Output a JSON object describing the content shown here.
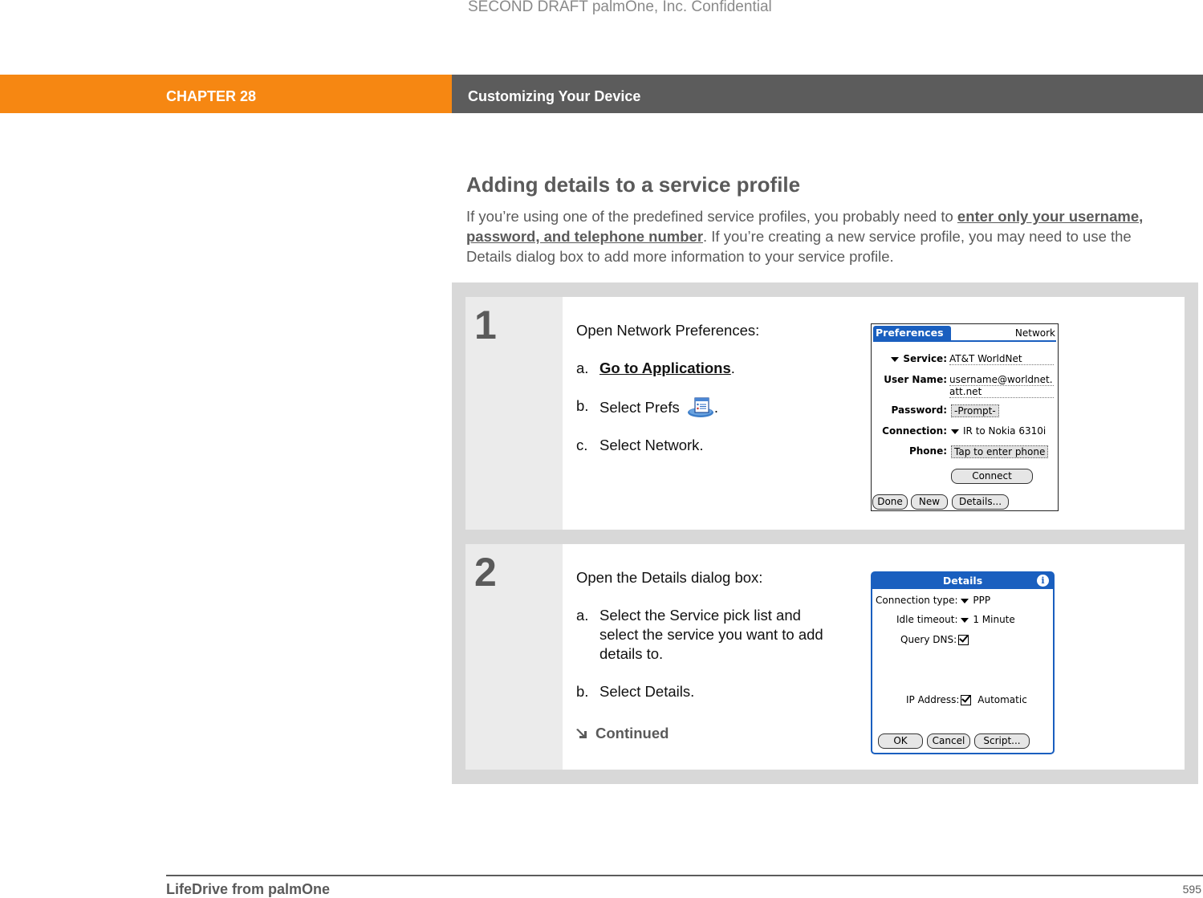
{
  "watermark": "SECOND DRAFT palmOne, Inc.  Confidential",
  "header": {
    "chapter_label": "CHAPTER 28",
    "chapter_title": "Customizing Your Device",
    "colors": {
      "chapter_bg": "#f68712",
      "title_bg": "#5c5c5c"
    }
  },
  "section": {
    "title": "Adding details to a service profile",
    "intro_before": "If you’re using one of the predefined service profiles, you probably need to ",
    "intro_link": "enter only your username, password, and telephone number",
    "intro_after": ". If you’re creating a new service profile, you may need to use the Details dialog box to add more information to your service profile."
  },
  "steps": [
    {
      "number": "1",
      "heading": "Open Network Preferences:",
      "items": [
        {
          "label": "a.",
          "link": "Go to Applications",
          "after": "."
        },
        {
          "label": "b.",
          "text": "Select Prefs",
          "icon": "prefs-app-icon",
          "after": "."
        },
        {
          "label": "c.",
          "text": "Select Network."
        }
      ],
      "screen": {
        "tab_title": "Preferences",
        "category": "Network",
        "fields": [
          {
            "label": "Service:",
            "value": "AT&T WorldNet",
            "picklist": true
          },
          {
            "label": "User Name:",
            "value": "username@worldnet.",
            "value2": "att.net"
          },
          {
            "label": "Password:",
            "value": "-Prompt-"
          },
          {
            "label": "Connection:",
            "value": "IR to Nokia 6310i",
            "picklist": true
          },
          {
            "label": "Phone:",
            "value": "Tap to enter phone"
          }
        ],
        "connect_button": "Connect",
        "buttons": [
          "Done",
          "New",
          "Details..."
        ]
      }
    },
    {
      "number": "2",
      "heading": "Open the Details dialog box:",
      "items": [
        {
          "label": "a.",
          "text": "Select the Service pick list and select the service you want to add details to."
        },
        {
          "label": "b.",
          "text": "Select Details."
        }
      ],
      "continued": "Continued",
      "screen": {
        "title": "Details",
        "info_icon": "i",
        "connection_type_label": "Connection type:",
        "connection_type_value": "PPP",
        "idle_timeout_label": "Idle timeout:",
        "idle_timeout_value": "1 Minute",
        "query_dns_label": "Query DNS:",
        "query_dns_checked": true,
        "ip_address_label": "IP Address:",
        "ip_address_checked": true,
        "ip_address_value": "Automatic",
        "buttons": [
          "OK",
          "Cancel",
          "Script..."
        ]
      }
    }
  ],
  "footer": {
    "book_title": "LifeDrive from palmOne",
    "page_number": "595"
  }
}
